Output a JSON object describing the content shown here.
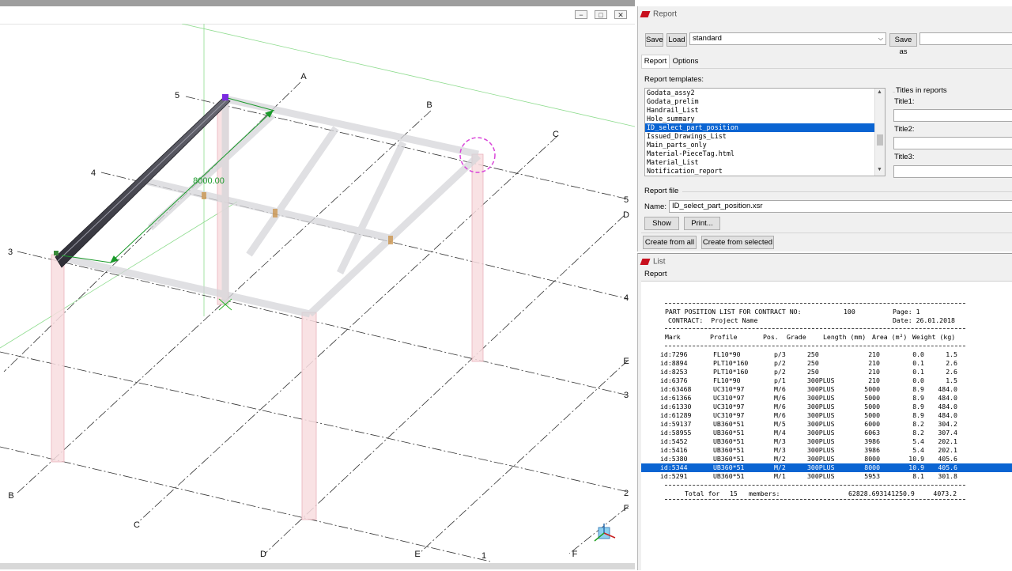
{
  "viewport": {
    "window_buttons": [
      "−",
      "□",
      "✕"
    ],
    "dimension_label": "8000.00",
    "grid_labels": {
      "A": "A",
      "B": "B",
      "C": "C",
      "D": "D",
      "E": "E",
      "F": "F",
      "n1": "1",
      "n2": "2",
      "n3": "3",
      "n4": "4",
      "n5": "5"
    },
    "colors": {
      "beam": "#4a4a52",
      "column": "#f3c7cc",
      "grid": "#222222",
      "dimension": "#1a9a2a",
      "guide": "#7cd67c"
    }
  },
  "report": {
    "title": "Report",
    "save_label": "Save",
    "load_label": "Load",
    "settings_value": "standard",
    "save_as_label": "Save as",
    "save_as_value": "",
    "tabs": [
      "Report",
      "Options"
    ],
    "templates_label": "Report templates:",
    "templates": [
      "Godata_assy2",
      "Godata_prelim",
      "Handrail_List",
      "Hole_summary",
      "ID_select_part_position",
      "Issued_Drawings_List",
      "Main_parts_only",
      "Material-PieceTag.html",
      "Material_List",
      "Notification_report"
    ],
    "selected_template": "ID_select_part_position",
    "titles_group_label": "Titles in reports",
    "title1_label": "Title1:",
    "title2_label": "Title2:",
    "title3_label": "Title3:",
    "title1_value": "",
    "title2_value": "",
    "title3_value": "",
    "report_file_label": "Report file",
    "name_label": "Name:",
    "name_value": "ID_select_part_position.xsr",
    "show_label": "Show",
    "print_label": "Print...",
    "create_all_label": "Create from all",
    "create_selected_label": "Create from selected"
  },
  "list": {
    "title": "List",
    "menu_label": "Report",
    "header_line1_left": "PART POSITION LIST FOR CONTRACT NO:",
    "contract_no": "100",
    "page_label": "Page: 1",
    "header_line2_left": "CONTRACT:  Project Name",
    "date_label": "Date: 26.01.2018",
    "columns": [
      "Mark",
      "Profile",
      "Pos.",
      "Grade",
      "Length (mm)",
      "Area (m²)",
      "Weight (kg)"
    ],
    "rows": [
      [
        "id:7296",
        "FL10*90",
        "p/3",
        "250",
        "210",
        "0.0",
        "1.5"
      ],
      [
        "id:8894",
        "PLT10*160",
        "p/2",
        "250",
        "210",
        "0.1",
        "2.6"
      ],
      [
        "id:8253",
        "PLT10*160",
        "p/2",
        "250",
        "210",
        "0.1",
        "2.6"
      ],
      [
        "id:6376",
        "FL10*90",
        "p/1",
        "300PLUS",
        "210",
        "0.0",
        "1.5"
      ],
      [
        "id:63468",
        "UC310*97",
        "M/6",
        "300PLUS",
        "5000",
        "8.9",
        "484.0"
      ],
      [
        "id:61366",
        "UC310*97",
        "M/6",
        "300PLUS",
        "5000",
        "8.9",
        "484.0"
      ],
      [
        "id:61330",
        "UC310*97",
        "M/6",
        "300PLUS",
        "5000",
        "8.9",
        "484.0"
      ],
      [
        "id:61289",
        "UC310*97",
        "M/6",
        "300PLUS",
        "5000",
        "8.9",
        "484.0"
      ],
      [
        "id:59137",
        "UB360*51",
        "M/5",
        "300PLUS",
        "6000",
        "8.2",
        "304.2"
      ],
      [
        "id:58955",
        "UB360*51",
        "M/4",
        "300PLUS",
        "6063",
        "8.2",
        "307.4"
      ],
      [
        "id:5452",
        "UB360*51",
        "M/3",
        "300PLUS",
        "3986",
        "5.4",
        "202.1"
      ],
      [
        "id:5416",
        "UB360*51",
        "M/3",
        "300PLUS",
        "3986",
        "5.4",
        "202.1"
      ],
      [
        "id:5380",
        "UB360*51",
        "M/2",
        "300PLUS",
        "8000",
        "10.9",
        "405.6"
      ],
      [
        "id:5344",
        "UB360*51",
        "M/2",
        "300PLUS",
        "8000",
        "10.9",
        "405.6"
      ],
      [
        "id:5291",
        "UB360*51",
        "M/1",
        "300PLUS",
        "5953",
        "8.1",
        "301.8"
      ]
    ],
    "selected_row": 13,
    "total_label": "Total for",
    "total_count": "15",
    "members_label": "members:",
    "total_length_area": "62828.693141250.9",
    "total_weight": "4073.2"
  }
}
